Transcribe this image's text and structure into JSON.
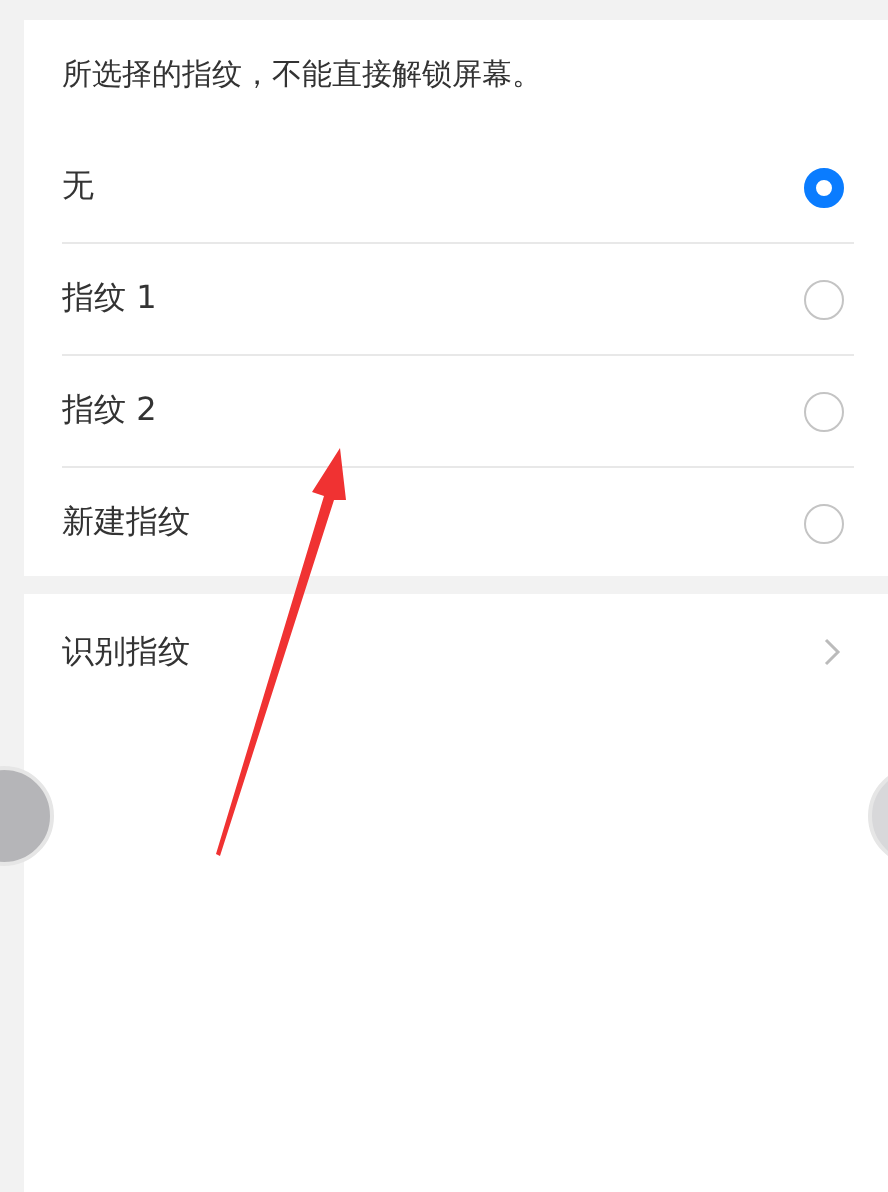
{
  "notice": "所选择的指纹，不能直接解锁屏幕。",
  "options": [
    {
      "label": "无",
      "selected": true
    },
    {
      "label": "指纹 1",
      "selected": false
    },
    {
      "label": "指纹 2",
      "selected": false
    },
    {
      "label": "新建指纹",
      "selected": false
    }
  ],
  "entries": [
    {
      "label": "识别指纹"
    }
  ]
}
